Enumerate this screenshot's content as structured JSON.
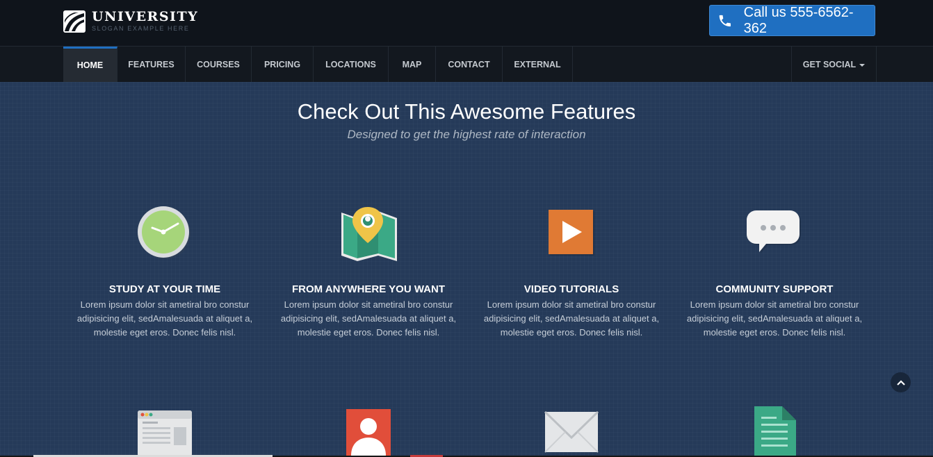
{
  "header": {
    "logo_title": "UNIVERSITY",
    "logo_slogan": "SLOGAN EXAMPLE HERE",
    "call_label": "Call us 555-6562-362",
    "call_icon": "phone-icon"
  },
  "nav": {
    "items": [
      {
        "label": "HOME",
        "active": true
      },
      {
        "label": "FEATURES"
      },
      {
        "label": "COURSES"
      },
      {
        "label": "PRICING"
      },
      {
        "label": "LOCATIONS"
      },
      {
        "label": "MAP"
      },
      {
        "label": "CONTACT"
      },
      {
        "label": "EXTERNAL"
      }
    ],
    "social_label": "GET SOCIAL"
  },
  "features": {
    "title": "Check Out This Awesome Features",
    "subtitle": "Designed to get the highest rate of interaction",
    "items": [
      {
        "title": "STUDY AT YOUR TIME",
        "text": "Lorem ipsum dolor sit ametiral bro constur adipisicing elit, sedAmalesuada at aliquet a, molestie eget eros. Donec felis nisl.",
        "icon": "clock-icon"
      },
      {
        "title": "FROM ANYWHERE YOU WANT",
        "text": "Lorem ipsum dolor sit ametiral bro constur adipisicing elit, sedAmalesuada at aliquet a, molestie eget eros. Donec felis nisl.",
        "icon": "map-pin-icon"
      },
      {
        "title": "VIDEO TUTORIALS",
        "text": "Lorem ipsum dolor sit ametiral bro constur adipisicing elit, sedAmalesuada at aliquet a, molestie eget eros. Donec felis nisl.",
        "icon": "play-icon"
      },
      {
        "title": "COMMUNITY SUPPORT",
        "text": "Lorem ipsum dolor sit ametiral bro constur adipisicing elit, sedAmalesuada at aliquet a, molestie eget eros. Donec felis nisl.",
        "icon": "chat-bubble-icon"
      }
    ],
    "second_row_icons": [
      "browser-window-icon",
      "user-icon",
      "envelope-icon",
      "document-icon"
    ]
  },
  "colors": {
    "brand_blue": "#1f6fc1",
    "background": "#253a59",
    "topbar": "#0f141b"
  }
}
